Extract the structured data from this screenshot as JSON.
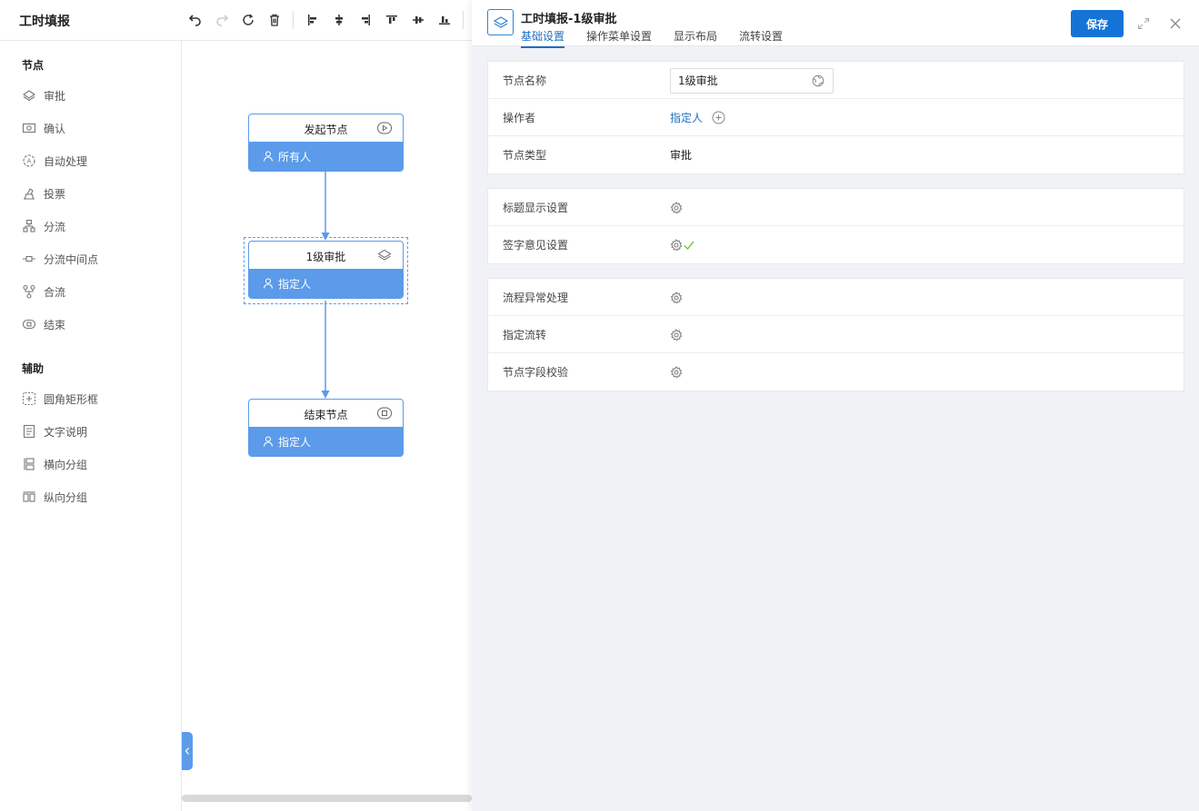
{
  "app": {
    "title": "工时填报"
  },
  "palette": {
    "sections": {
      "nodes": "节点",
      "aux": "辅助"
    },
    "node_items": [
      {
        "label": "审批",
        "icon": "approve-icon"
      },
      {
        "label": "确认",
        "icon": "confirm-icon"
      },
      {
        "label": "自动处理",
        "icon": "auto-process-icon"
      },
      {
        "label": "投票",
        "icon": "vote-icon"
      },
      {
        "label": "分流",
        "icon": "split-icon"
      },
      {
        "label": "分流中间点",
        "icon": "split-midpoint-icon"
      },
      {
        "label": "合流",
        "icon": "merge-icon"
      },
      {
        "label": "结束",
        "icon": "end-icon"
      }
    ],
    "aux_items": [
      {
        "label": "圆角矩形框",
        "icon": "rounded-rect-icon"
      },
      {
        "label": "文字说明",
        "icon": "text-note-icon"
      },
      {
        "label": "横向分组",
        "icon": "horizontal-group-icon"
      },
      {
        "label": "纵向分组",
        "icon": "vertical-group-icon"
      }
    ]
  },
  "flow": {
    "nodes": [
      {
        "title": "发起节点",
        "operator": "所有人",
        "icon": "play-icon"
      },
      {
        "title": "1级审批",
        "operator": "指定人",
        "icon": "approve-icon",
        "selected": true
      },
      {
        "title": "结束节点",
        "operator": "指定人",
        "icon": "end-icon"
      }
    ]
  },
  "panel": {
    "title": "工时填报-1级审批",
    "tabs": [
      "基础设置",
      "操作菜单设置",
      "显示布局",
      "流转设置"
    ],
    "active_tab": "基础设置",
    "save_label": "保存",
    "basic": {
      "name_label": "节点名称",
      "name_value": "1级审批",
      "operator_label": "操作者",
      "operator_value": "指定人",
      "type_label": "节点类型",
      "type_value": "审批"
    },
    "display": {
      "title_setting": "标题显示设置",
      "sign_setting": "签字意见设置",
      "sign_configured": true
    },
    "advanced": {
      "exception": "流程异常处理",
      "assign_flow": "指定流转",
      "field_check": "节点字段校验"
    }
  },
  "colors": {
    "accent": "#1473d6",
    "node_blue": "#5b9bea",
    "check_green": "#52c41a"
  }
}
